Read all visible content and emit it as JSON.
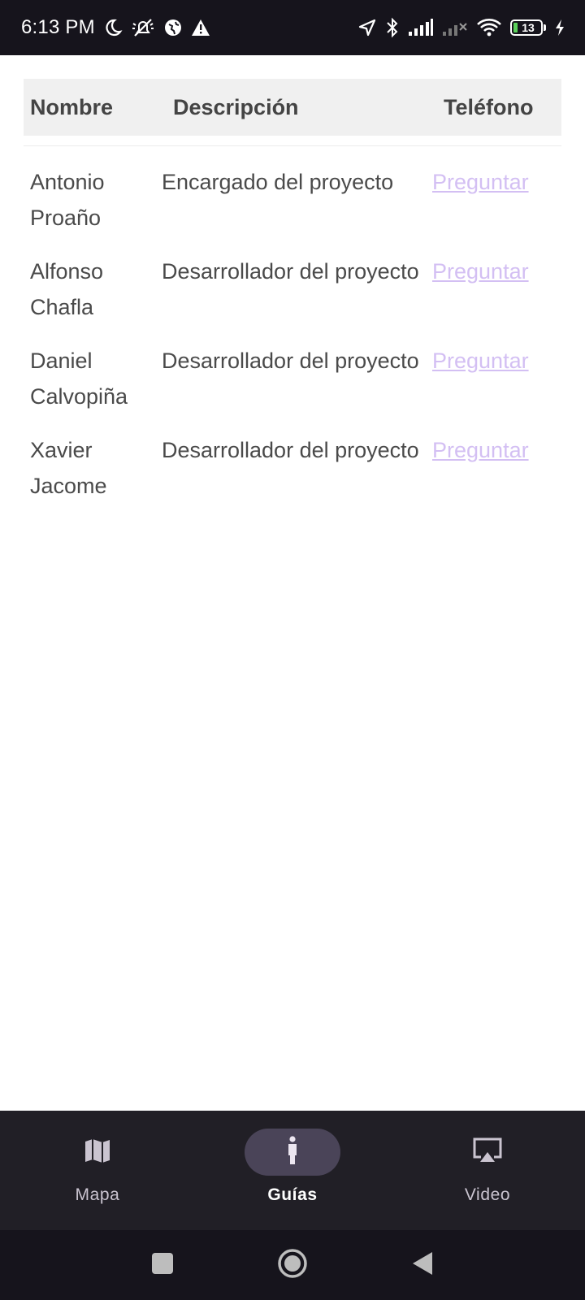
{
  "status_bar": {
    "time": "6:13 PM",
    "battery_level": "13",
    "icons_left": [
      "moon-icon",
      "silent-alarm-icon",
      "vpn-icon",
      "warning-icon"
    ],
    "icons_right": [
      "location-icon",
      "bluetooth-icon",
      "signal-icon",
      "signal-off-icon",
      "wifi-icon",
      "battery-icon",
      "charging-icon"
    ]
  },
  "table": {
    "headers": {
      "name": "Nombre",
      "description": "Descripción",
      "phone": "Teléfono"
    },
    "rows": [
      {
        "name": "Antonio Proaño",
        "description": "Encargado del proyecto",
        "phone_link": "Preguntar"
      },
      {
        "name": "Alfonso Chafla",
        "description": "Desarrollador del proyecto",
        "phone_link": "Preguntar"
      },
      {
        "name": "Daniel Calvopiña",
        "description": "Desarrollador del proyecto",
        "phone_link": "Preguntar"
      },
      {
        "name": "Xavier Jacome",
        "description": "Desarrollador del proyecto",
        "phone_link": "Preguntar"
      }
    ],
    "link_color": "#d3bff3"
  },
  "bottom_nav": {
    "items": [
      {
        "label": "Mapa",
        "icon": "map-icon",
        "active": false
      },
      {
        "label": "Guías",
        "icon": "person-icon",
        "active": true
      },
      {
        "label": "Video",
        "icon": "airplay-icon",
        "active": false
      }
    ],
    "active_pill_color": "#4a4458"
  },
  "system_nav": {
    "buttons": [
      "recents-square-icon",
      "home-circle-icon",
      "back-triangle-icon"
    ]
  }
}
